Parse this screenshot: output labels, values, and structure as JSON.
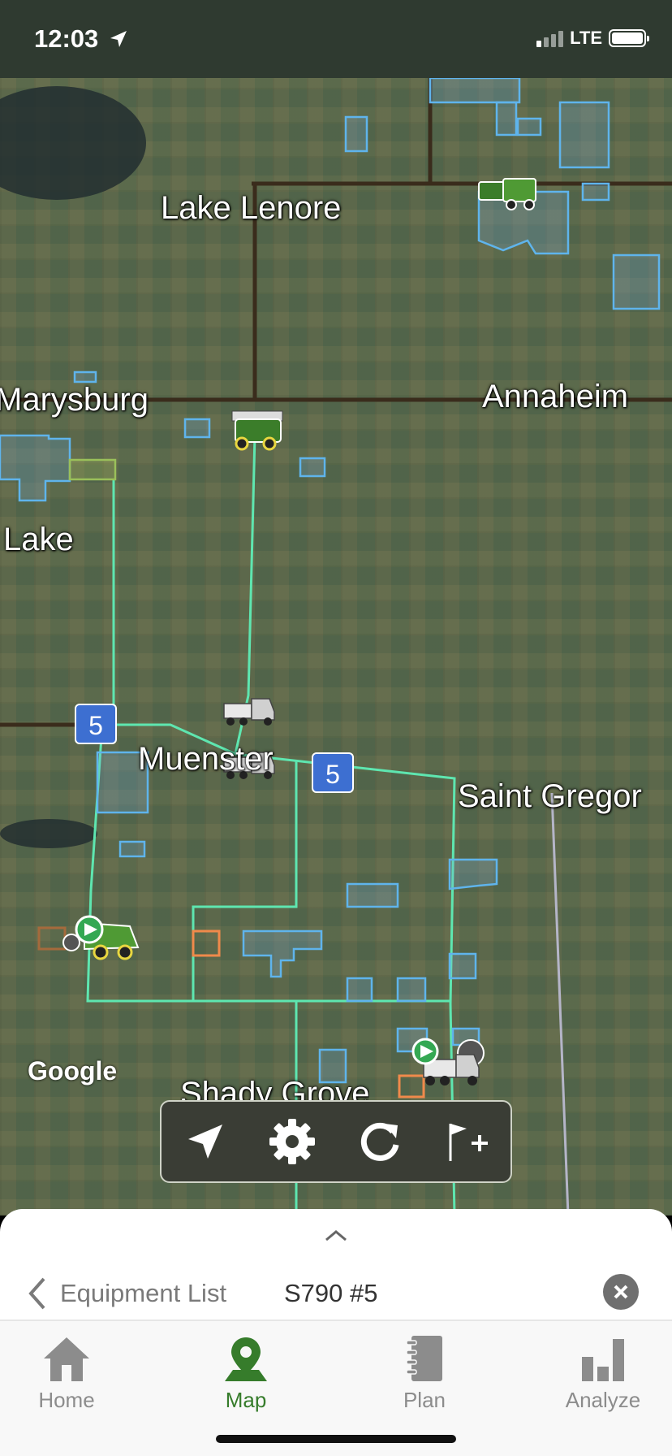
{
  "status_bar": {
    "time": "12:03",
    "network": "LTE",
    "location_icon": "location-arrow-icon"
  },
  "map": {
    "labels": {
      "lake_lenore": "Lake Lenore",
      "marysburg": "Marysburg",
      "annaheim": "Annaheim",
      "lake": "Lake",
      "muenster": "Muenster",
      "saint_gregor": "Saint Gregor",
      "shady_grove": "Shady Grove"
    },
    "highway_shields": [
      "5",
      "5"
    ],
    "attribution": "Google",
    "colors": {
      "field_boundary": "#5fb4ec",
      "route": "#5ee6b0",
      "orange_boundary": "#f08a4b",
      "shield": "#3d6fd1"
    },
    "vehicles": [
      "combine-icon",
      "combine-icon",
      "semi-truck-icon",
      "semi-truck-icon",
      "combine-icon",
      "semi-truck-icon"
    ]
  },
  "map_toolbar": {
    "buttons": [
      "locate-icon",
      "settings-gear-icon",
      "refresh-icon",
      "add-flag-icon"
    ]
  },
  "bottom_sheet": {
    "back_label": "Equipment List",
    "selected_equipment": "S790 #5"
  },
  "tab_bar": {
    "active_color": "#367c2b",
    "tabs": [
      {
        "label": "Home",
        "icon": "home-icon",
        "active": false
      },
      {
        "label": "Map",
        "icon": "map-pin-icon",
        "active": true
      },
      {
        "label": "Plan",
        "icon": "plan-notebook-icon",
        "active": false
      },
      {
        "label": "Analyze",
        "icon": "bar-chart-icon",
        "active": false
      }
    ]
  }
}
